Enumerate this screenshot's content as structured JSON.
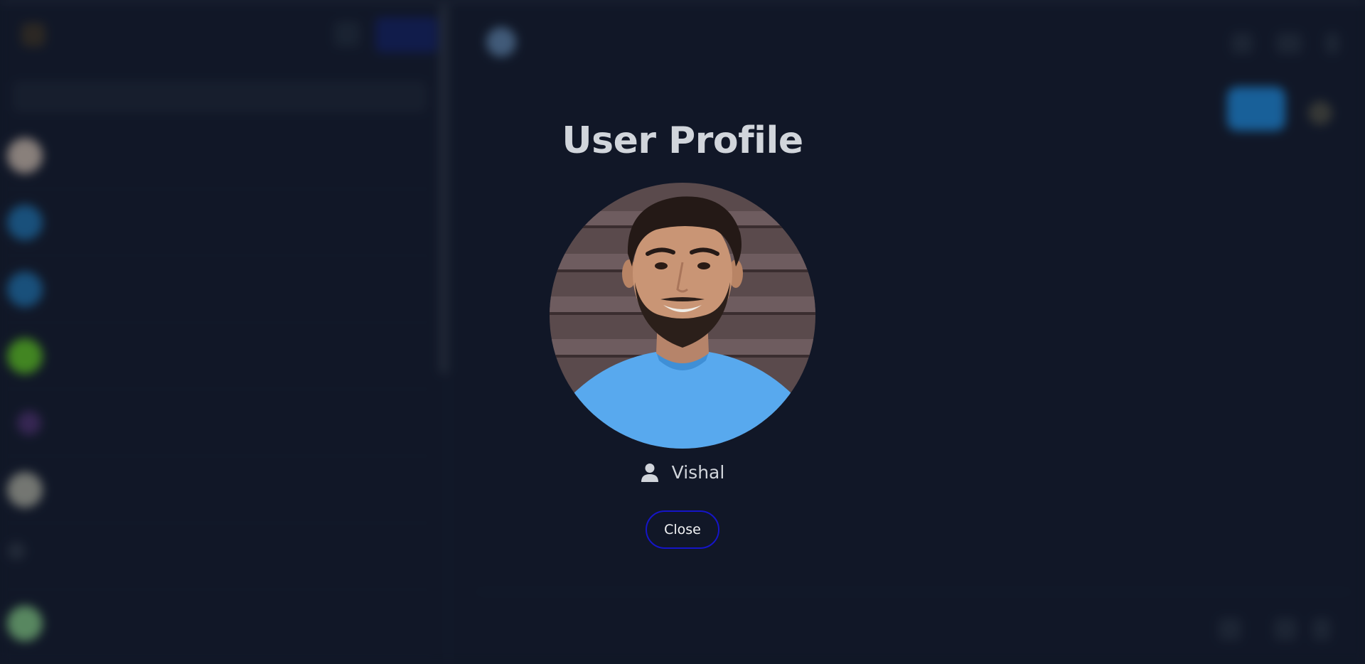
{
  "sidebar": {
    "title": "",
    "new_label": "",
    "search_placeholder": "",
    "avatar_colors": [
      "#c9b8a8",
      "#1e6fa8",
      "#1e6fa8",
      "#5cc11f",
      "#6b3f8a",
      "#a9aa9a",
      "#1f2937",
      "#7fc47f"
    ]
  },
  "main": {
    "contact_name": "",
    "composer_placeholder": ""
  },
  "modal": {
    "title": "User Profile",
    "user_name": "Vishal",
    "close_label": "Close",
    "photo": "profile-photo-of-smiling-man-in-blue-tshirt",
    "user_icon": "user-icon",
    "close_border_color": "#1515c8"
  }
}
